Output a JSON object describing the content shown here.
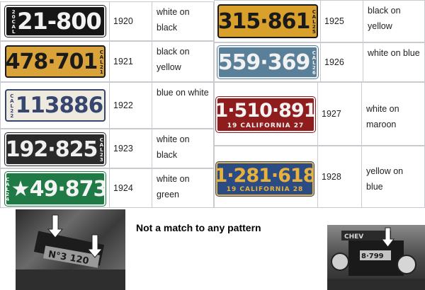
{
  "left_rows": [
    {
      "plate": "21-800",
      "state": "20CAL",
      "year": "1920",
      "color": "white on black",
      "bg": "#161616",
      "fg": "#f2f2f2"
    },
    {
      "plate": "478·701",
      "state": "CAL21",
      "year": "1921",
      "color": "black on yellow",
      "bg": "#d9a33a",
      "fg": "#1a1a1a"
    },
    {
      "plate": "113886",
      "state": "CAL22",
      "year": "1922",
      "color": "blue on white",
      "bg": "#efeae0",
      "fg": "#37466e"
    },
    {
      "plate": "192·825",
      "state": "CAL23",
      "year": "1923",
      "color": "white on black",
      "bg": "#2a2a2a",
      "fg": "#f0f0f0"
    },
    {
      "plate": "★49·873",
      "state": "CAL24",
      "year": "1924",
      "color": "white on green",
      "bg": "#1f7a45",
      "fg": "#f4f4f4"
    }
  ],
  "right_rows": [
    {
      "plate": "315·861",
      "state": "CAL25",
      "year": "1925",
      "color": "black on yellow",
      "bg": "#d9a02c",
      "fg": "#1a1a1a"
    },
    {
      "plate": "559·369",
      "state": "CAL26",
      "year": "1926",
      "color": "white on blue",
      "bg": "#5a7f98",
      "fg": "#f2f2f2"
    },
    {
      "plate": "1·510·891",
      "bottom": "19 CALIFORNIA 27",
      "year": "1927",
      "color": "white on maroon",
      "bg": "#8f1d1d",
      "fg": "#f4f4f4"
    },
    {
      "plate": "1·281·618",
      "bottom": "19 CALIFORNIA 28",
      "year": "1928",
      "color": "yellow on blue",
      "bg": "#2b4b84",
      "fg": "#e8b23a"
    }
  ],
  "caption": "Not a match to any pattern"
}
